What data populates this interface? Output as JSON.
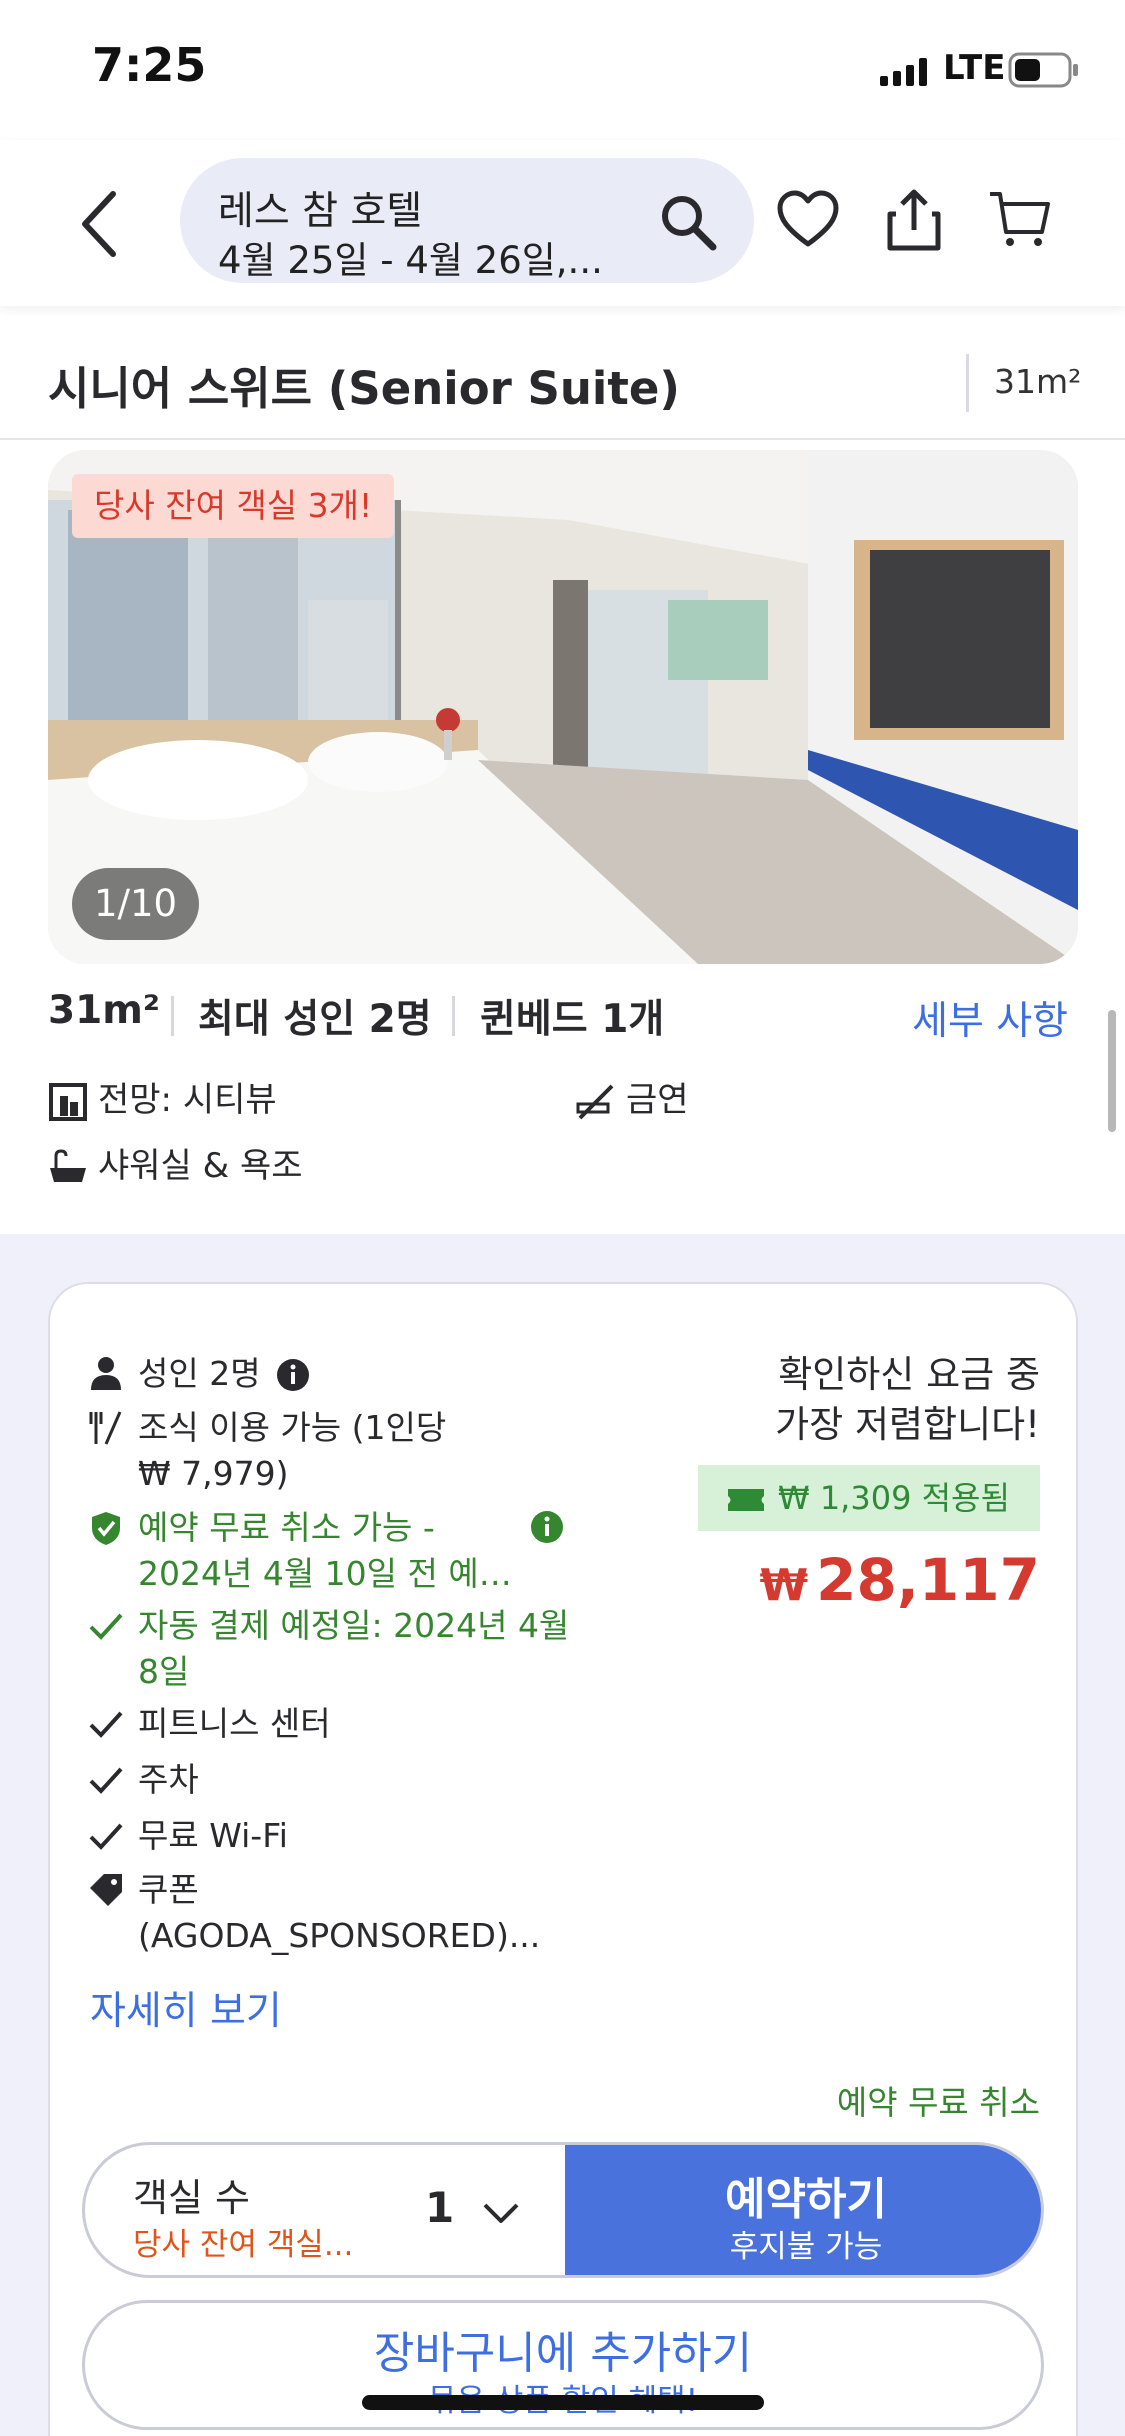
{
  "status_bar": {
    "time": "7:25",
    "network": "LTE"
  },
  "header": {
    "hotel_name": "레스 참 호텔",
    "dates": "4월 25일 - 4월 26일,...",
    "icons": [
      "back-chevron-icon",
      "search-icon",
      "heart-icon",
      "share-icon",
      "cart-icon"
    ]
  },
  "room": {
    "title": "시니어 스위트 (Senior Suite)",
    "size": "31m²",
    "photo": {
      "badge": "당사 잔여 객실 3개!",
      "counter": "1/10"
    },
    "specs": {
      "area": "31m²",
      "max_guests": "최대 성인 2명",
      "bed": "퀸베드 1개",
      "details_link": "세부 사항"
    },
    "features": [
      {
        "icon": "city-view-icon",
        "label": "전망: 시티뷰"
      },
      {
        "icon": "no-smoking-icon",
        "label": "금연"
      },
      {
        "icon": "bathtub-icon",
        "label": "샤워실 & 욕조"
      }
    ]
  },
  "offer": {
    "guests": "성인 2명",
    "breakfast_line1": "조식 이용 가능 (1인당",
    "breakfast_line2": "₩ 7,979)",
    "cancel_line1": "예약 무료 취소 가능 -",
    "cancel_line2": "2024년 4월 10일 전 예…",
    "autopay_line1": "자동 결제 예정일: 2024년 4월",
    "autopay_line2": "8일",
    "fitness": "피트니스 센터",
    "parking": "주차",
    "wifi": "무료 Wi-Fi",
    "coupon_line1": "쿠폰",
    "coupon_line2": "(AGODA_SPONSORED)...",
    "see_more": "자세히 보기",
    "cheapest_line1": "확인하신 요금 중",
    "cheapest_line2": "가장 저렴합니다!",
    "saving": "₩ 1,309 적용됨",
    "currency": "₩",
    "price": "28,117",
    "free_cancel": "예약 무료 취소",
    "colors": {
      "price": "#d43a2f",
      "green": "#35862f",
      "accent": "#4a72dc"
    }
  },
  "booking": {
    "rooms_label": "객실 수",
    "rooms_sub": "당사 잔여 객실...",
    "rooms_qty": "1",
    "book_label": "예약하기",
    "book_sub": "후지불 가능",
    "cart_label": "장바구니에 추가하기",
    "cart_sub": "묶음 상품 할인 혜택!"
  }
}
